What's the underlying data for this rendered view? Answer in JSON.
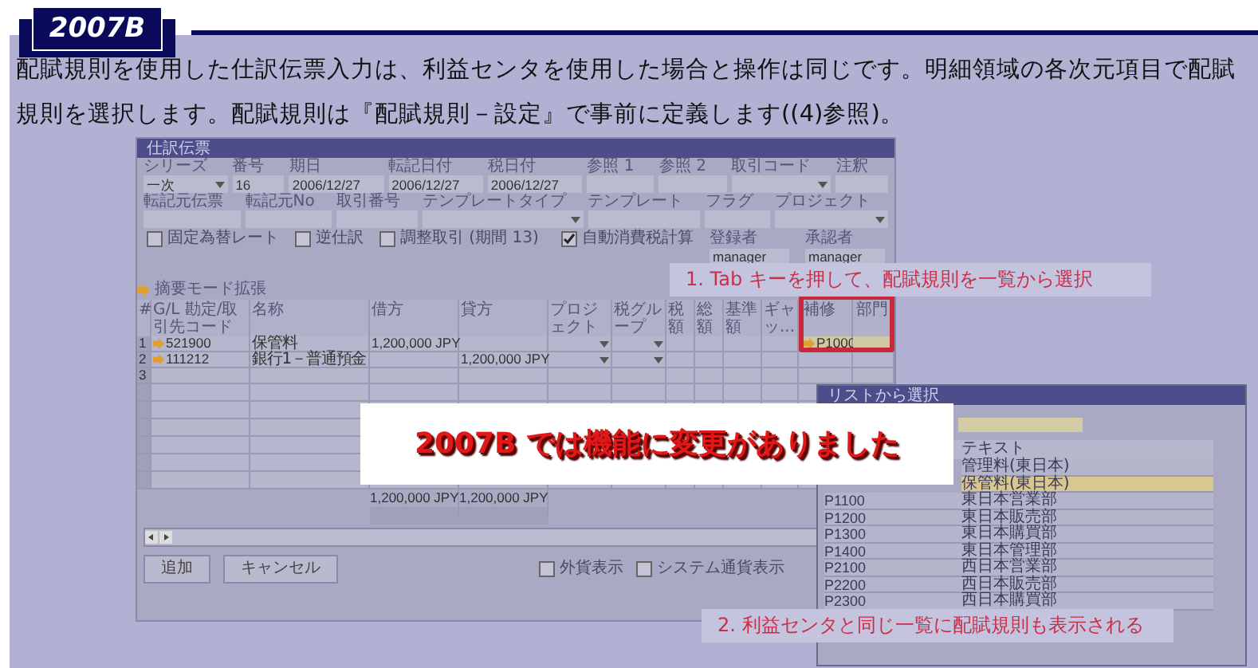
{
  "badge": "2007B",
  "intro": "配賦規則を使用した仕訳伝票入力は、利益センタを使用した場合と操作は同じです。明細領域の各次元項目で配賦規則を選択します。配賦規則は『配賦規則－設定』で事前に定義します((4)参照)。",
  "window": {
    "title": "仕訳伝票",
    "header_fields": [
      {
        "label": "シリーズ",
        "value": "一次",
        "kind": "dropdown"
      },
      {
        "label": "番号",
        "value": "16",
        "kind": "text"
      },
      {
        "label": "期日",
        "value": "2006/12/27",
        "kind": "text"
      },
      {
        "label": "転記日付",
        "value": "2006/12/27",
        "kind": "text"
      },
      {
        "label": "税日付",
        "value": "2006/12/27",
        "kind": "text"
      },
      {
        "label": "参照 1",
        "kind": "text"
      },
      {
        "label": "参照 2",
        "kind": "text"
      },
      {
        "label": "取引コード",
        "kind": "dropdown"
      },
      {
        "label": "注釈",
        "kind": "text"
      }
    ],
    "detail_fields": [
      {
        "label": "転記元伝票",
        "kind": "text"
      },
      {
        "label": "転記元No",
        "kind": "text"
      },
      {
        "label": "取引番号",
        "kind": "text"
      },
      {
        "label": "テンプレートタイプ",
        "kind": "dropdown"
      },
      {
        "label": "テンプレート",
        "kind": "text"
      },
      {
        "label": "フラグ",
        "kind": "text"
      },
      {
        "label": "プロジェクト",
        "kind": "dropdown"
      }
    ],
    "checkboxes": [
      {
        "label": "固定為替レート",
        "checked": false
      },
      {
        "label": "逆仕訳",
        "checked": false
      },
      {
        "label": "調整取引 (期間 13)",
        "checked": false
      },
      {
        "label": "自動消費税計算",
        "checked": true
      }
    ],
    "users": [
      {
        "label": "登録者",
        "value": "manager"
      },
      {
        "label": "承認者",
        "value": "manager"
      }
    ],
    "section_label": "摘要モード拡張",
    "table": {
      "columns": [
        {
          "label": "#",
          "kind": "text"
        },
        {
          "label": "G/L 勘定/取引先コード",
          "kind": "text"
        },
        {
          "label": "名称",
          "kind": "text"
        },
        {
          "label": "借方",
          "kind": "text"
        },
        {
          "label": "貸方",
          "kind": "text"
        },
        {
          "label": "プロジェクト",
          "kind": "dropdown"
        },
        {
          "label": "税グループ",
          "kind": "dropdown"
        },
        {
          "label": "税額",
          "kind": "text"
        },
        {
          "label": "総額",
          "kind": "text"
        },
        {
          "label": "基準額",
          "kind": "text"
        },
        {
          "label": "ギャッ...",
          "kind": "text"
        },
        {
          "label": "補修",
          "kind": "text"
        },
        {
          "label": "部門",
          "kind": "text"
        }
      ],
      "rows": [
        {
          "link": true,
          "highlighted": true,
          "cells": [
            "1",
            "521900",
            "保管料",
            "1,200,000 JPY",
            null,
            null,
            null,
            null,
            null,
            null,
            null,
            "P1000",
            null
          ]
        },
        {
          "link": true,
          "highlighted": false,
          "cells": [
            "2",
            "111212",
            "銀行1－普通預金",
            null,
            "1,200,000 JPY",
            null,
            null,
            null,
            null,
            null,
            null,
            null,
            null
          ]
        },
        {
          "link": false,
          "highlighted": false,
          "cells": [
            "3",
            null,
            null,
            null,
            null,
            null,
            null,
            null,
            null,
            null,
            null,
            null,
            null
          ]
        }
      ],
      "totals": [
        "1,200,000 JPY",
        "1,200,000 JPY"
      ]
    },
    "buttons": [
      "追加",
      "キャンセル"
    ],
    "footer_checkboxes": [
      {
        "label": "外貨表示",
        "checked": false
      },
      {
        "label": "システム通貨表示",
        "checked": false
      }
    ]
  },
  "callouts": [
    "1. Tab キーを押して、配賦規則を一覧から選択",
    "2. 利益センタと同じ一覧に配賦規則も表示される"
  ],
  "notice": "2007B では機能に変更がありました",
  "popup": {
    "title": "リストから選択",
    "columns": [
      "テキスト"
    ],
    "rows": [
      {
        "text": "管理料(東日本)",
        "selected": false
      },
      {
        "text": "保管料(東日本)",
        "selected": true
      },
      {
        "code": "P1100",
        "text": "東日本営業部",
        "selected": false
      },
      {
        "code": "P1200",
        "text": "東日本販売部",
        "selected": false
      },
      {
        "code": "P1300",
        "text": "東日本購買部",
        "selected": false
      },
      {
        "code": "P1400",
        "text": "東日本管理部",
        "selected": false
      },
      {
        "code": "P2100",
        "text": "西日本営業部",
        "selected": false
      },
      {
        "code": "P2200",
        "text": "西日本販売部",
        "selected": false
      },
      {
        "code": "P2300",
        "text": "西日本購買部",
        "selected": false
      }
    ]
  }
}
